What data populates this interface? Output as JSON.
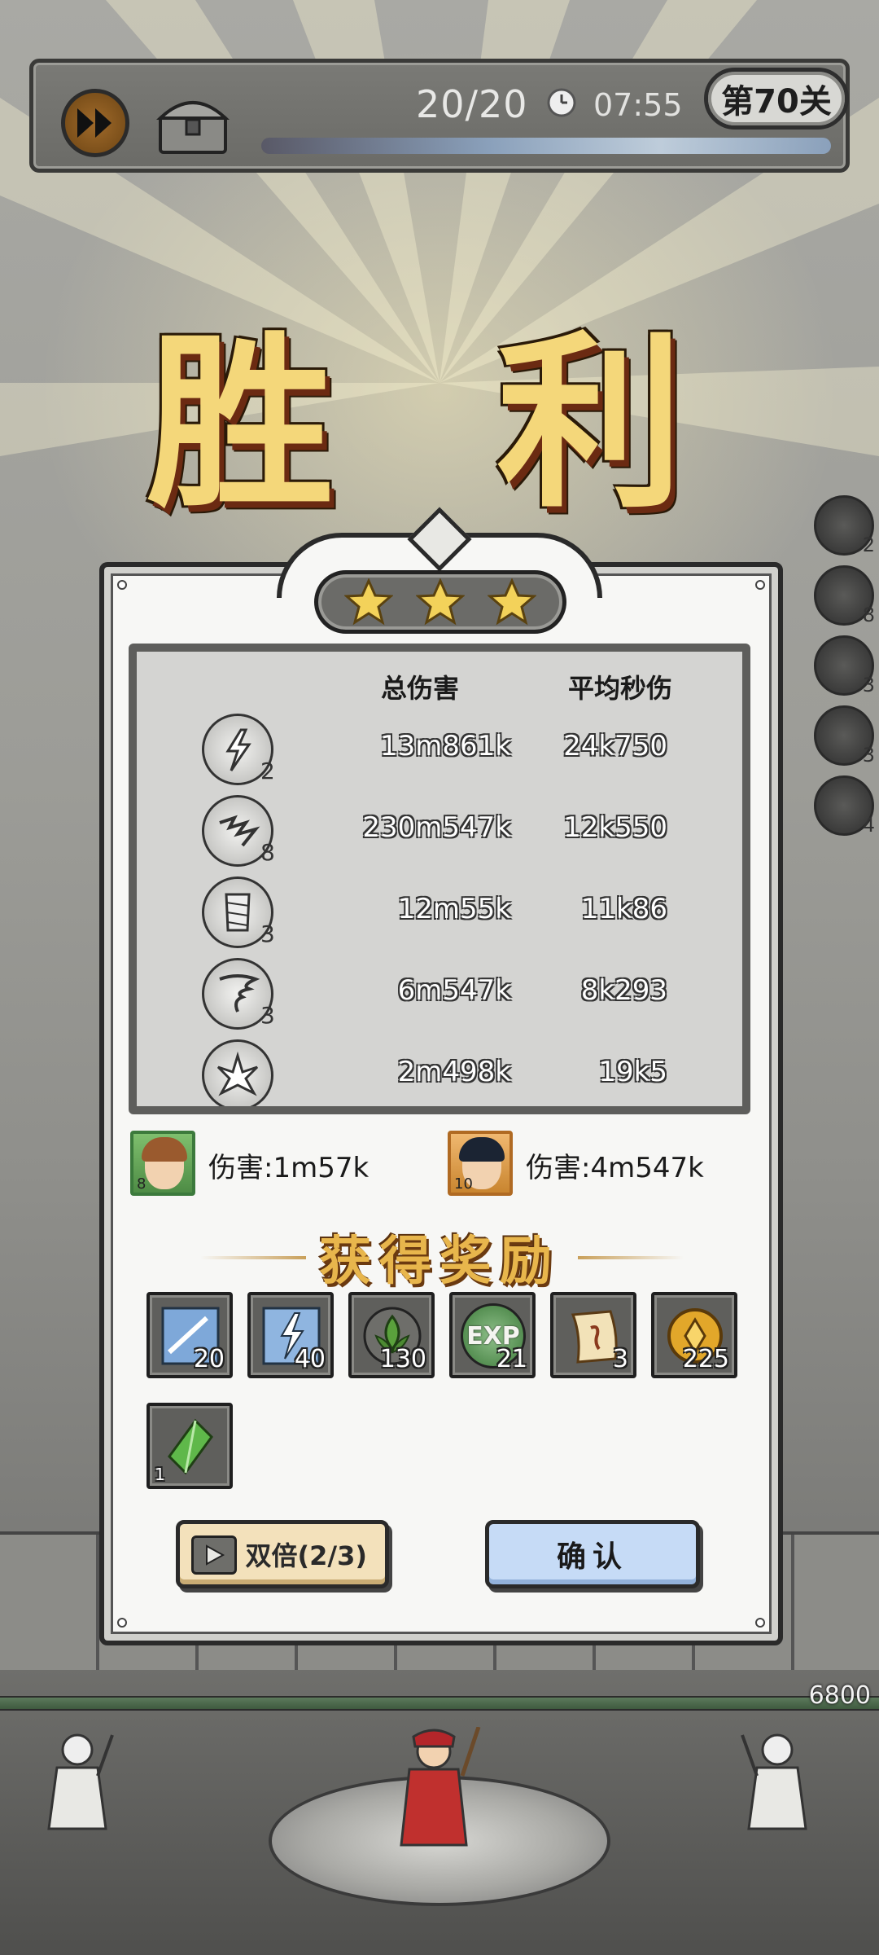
{
  "topbar": {
    "wave": "20/20",
    "timer": "07:55",
    "level": "第70关"
  },
  "victory_title": "胜 利",
  "side_skills": [
    {
      "level": "2"
    },
    {
      "level": "8"
    },
    {
      "level": "3"
    },
    {
      "level": "3"
    },
    {
      "level": "4"
    }
  ],
  "stats": {
    "col_total": "总伤害",
    "col_dps": "平均秒伤",
    "rows": [
      {
        "level": "2",
        "total": "13m861k",
        "dps": "24k750"
      },
      {
        "level": "8",
        "total": "230m547k",
        "dps": "12k550"
      },
      {
        "level": "3",
        "total": "12m55k",
        "dps": "11k86"
      },
      {
        "level": "3",
        "total": "6m547k",
        "dps": "8k293"
      },
      {
        "level": "",
        "total": "2m498k",
        "dps": "19k5"
      }
    ]
  },
  "heroes": [
    {
      "level": "8",
      "damage": "伤害:1m57k"
    },
    {
      "level": "10",
      "damage": "伤害:4m547k"
    }
  ],
  "rewards_title": "获得奖励",
  "rewards": [
    {
      "icon": "blue-crystal-shard-icon",
      "count": "20"
    },
    {
      "icon": "lightning-crystal-icon",
      "count": "40"
    },
    {
      "icon": "green-leaf-emblem-icon",
      "count": "130"
    },
    {
      "icon": "exp-orb-icon",
      "label": "EXP",
      "count": "21"
    },
    {
      "icon": "scroll-icon",
      "count": "3"
    },
    {
      "icon": "gold-coin-icon",
      "count": "225"
    },
    {
      "icon": "green-gem-icon",
      "count": "1"
    }
  ],
  "buttons": {
    "double": "双倍(2/3)",
    "confirm": "确认"
  },
  "enemy_hp": "6800",
  "colors": {
    "victory_gold": "#f4d77a",
    "confirm_blue": "#c6dbf6",
    "double_cream": "#f3e1bb"
  }
}
